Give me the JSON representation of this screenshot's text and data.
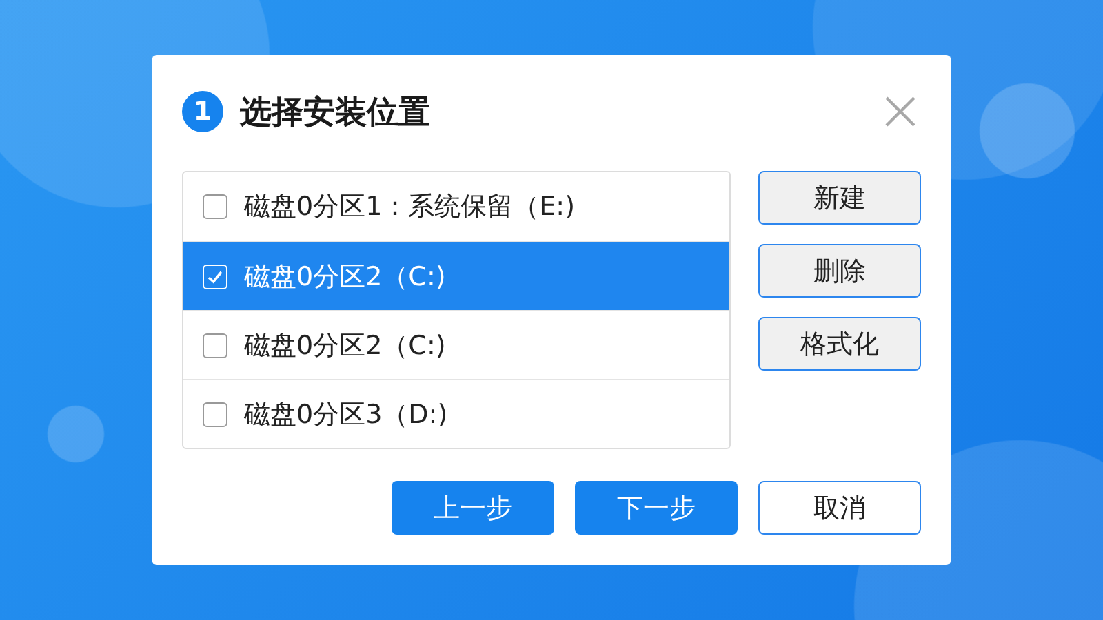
{
  "dialog": {
    "step": "1",
    "title": "选择安装位置"
  },
  "partitions": [
    {
      "label": "磁盘0分区1：系统保留（E:)",
      "checked": false,
      "selected": false
    },
    {
      "label": "磁盘0分区2（C:)",
      "checked": true,
      "selected": true
    },
    {
      "label": "磁盘0分区2（C:)",
      "checked": false,
      "selected": false
    },
    {
      "label": "磁盘0分区3（D:)",
      "checked": false,
      "selected": false
    }
  ],
  "side_buttons": [
    "新建",
    "删除",
    "格式化"
  ],
  "footer_buttons": [
    {
      "label": "上一步",
      "kind": "primary"
    },
    {
      "label": "下一步",
      "kind": "primary"
    },
    {
      "label": "取消",
      "kind": "default"
    }
  ]
}
